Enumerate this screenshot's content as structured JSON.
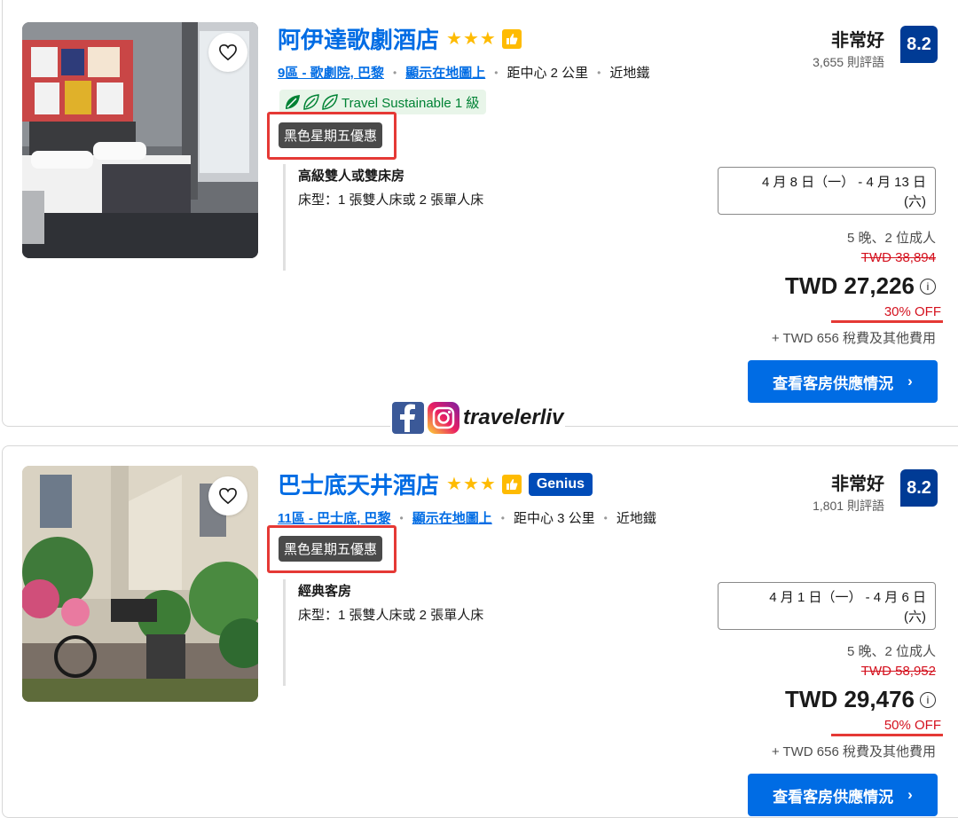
{
  "hotels": [
    {
      "name": "阿伊達歌劇酒店",
      "stars": "★★★",
      "genius": "",
      "district": "9區 - 歌劇院, 巴黎",
      "map_link": "顯示在地圖上",
      "distance": "距中心 2 公里",
      "metro": "近地鐵",
      "sustainable": "Travel Sustainable 1 級",
      "deal": "黑色星期五優惠",
      "room_title": "高級雙人或雙床房",
      "bed": "床型：1 張雙人床或 2 張單人床",
      "rating_word": "非常好",
      "reviews": "3,655 則評語",
      "score": "8.2",
      "dates_line1": "4 月 8 日（一） - 4 月 13 日",
      "dates_line2": "(六)",
      "nights": "5 晚、2 位成人",
      "old_price": "TWD 38,894",
      "price": "TWD 27,226",
      "discount": "30% OFF",
      "tax": "+ TWD 656 稅費及其他費用",
      "cta": "查看客房供應情況"
    },
    {
      "name": "巴士底天井酒店",
      "stars": "★★★",
      "genius": "Genius",
      "district": "11區 - 巴士底, 巴黎",
      "map_link": "顯示在地圖上",
      "distance": "距中心 3 公里",
      "metro": "近地鐵",
      "sustainable": "",
      "deal": "黑色星期五優惠",
      "room_title": "經典客房",
      "bed": "床型：1 張雙人床或 2 張單人床",
      "rating_word": "非常好",
      "reviews": "1,801 則評語",
      "score": "8.2",
      "dates_line1": "4 月 1 日（一） - 4 月 6 日",
      "dates_line2": "(六)",
      "nights": "5 晚、2 位成人",
      "old_price": "TWD 58,952",
      "price": "TWD 29,476",
      "discount": "50% OFF",
      "tax": "+ TWD 656 稅費及其他費用",
      "cta": "查看客房供應情況"
    }
  ],
  "watermark": {
    "handle": "travelerliv"
  },
  "colors": {
    "link": "#006ce4",
    "score_bg": "#003b95",
    "star": "#febb02",
    "deal_bg": "#4a4a4a",
    "highlight": "#e53935",
    "sustain": "#008234"
  }
}
